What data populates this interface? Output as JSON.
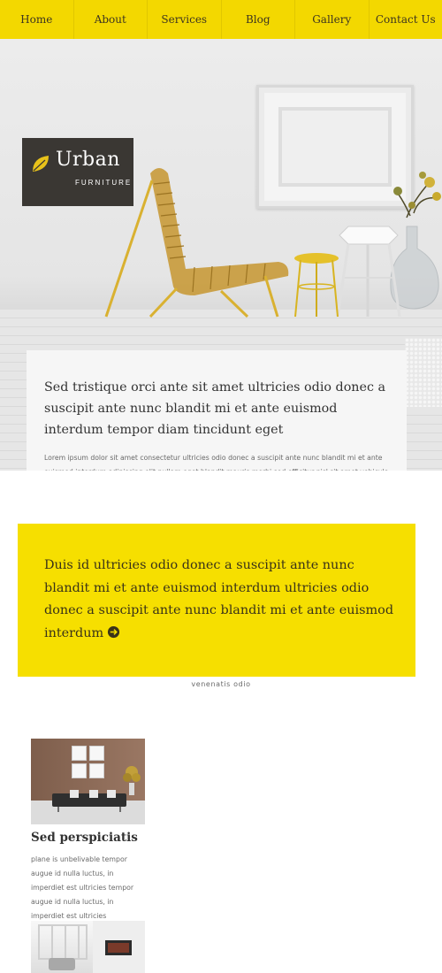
{
  "nav": {
    "items": [
      "Home",
      "About",
      "Services",
      "Blog",
      "Gallery",
      "Contact Us"
    ]
  },
  "hero": {
    "logo": {
      "title": "Urban",
      "subtitle": "FURNITURE"
    },
    "card": {
      "heading": "Sed tristique orci ante sit amet ultricies odio donec a suscipit ante nunc blandit mi et ante euismod interdum tempor diam tincidunt eget",
      "text": "Lorem ipsum dolor sit amet consectetur ultricies odio donec a suscipit ante nunc blandit mi et ante euismod interdum adipiscing elit nullam eget blandit mauris morbi sed efficitur nisl sit amet vehicula ante adipiscing elit nullam eget blandit mauris."
    }
  },
  "feature": {
    "text": "Duis id ultricies odio donec a suscipit ante nunc blandit mi et ante euismod interdum ultricies odio donec a suscipit ante nunc blandit mi et ante euismod interdum",
    "caption": "venenatis odio"
  },
  "gallery": {
    "items": [
      {
        "title": "Sed perspiciatis",
        "text": "plane is unbelivable tempor augue id nulla luctus, in imperdiet est ultricies tempor augue id nulla luctus, in imperdiet est ultricies"
      }
    ]
  },
  "colors": {
    "accent": "#f3d800",
    "feature_bg": "#f6df00",
    "card_bg": "#f6f6f6",
    "logo_bg": "#3a3733",
    "heading_text": "#333333",
    "body_text": "#6a6a6a"
  },
  "icons": [
    "leaf-icon",
    "arrow-right-circle-icon"
  ]
}
